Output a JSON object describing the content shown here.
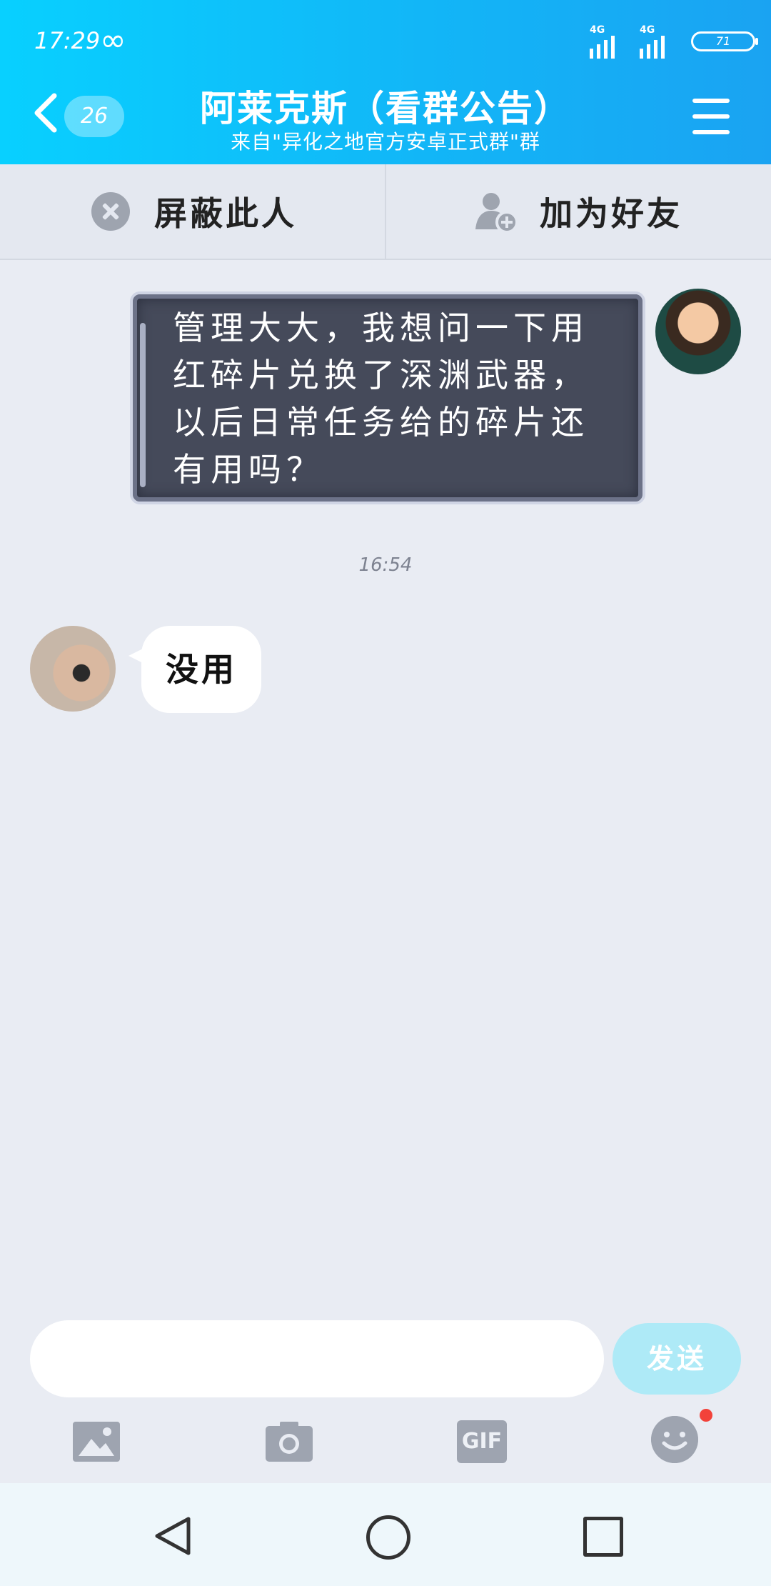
{
  "status_bar": {
    "time": "17:29",
    "infinity_glyph": "∞",
    "network_1": "4G",
    "network_2": "4G",
    "battery": "71"
  },
  "header": {
    "unread_count": "26",
    "title": "阿莱克斯（看群公告）",
    "subtitle": "来自\"异化之地官方安卓正式群\"群"
  },
  "actions": {
    "block_label": "屏蔽此人",
    "add_friend_label": "加为好友"
  },
  "messages": [
    {
      "side": "right",
      "text": "管理大大，我想问一下用红碎片兑换了深渊武器，以后日常任务给的碎片还有用吗？"
    },
    {
      "side": "left",
      "text": "没用"
    }
  ],
  "timestamp": "16:54",
  "input": {
    "placeholder": "",
    "send_label": "发送"
  },
  "toolbar": {
    "gif_label": "GIF"
  },
  "colors": {
    "header_start": "#08d0ff",
    "header_end": "#1aa3f2",
    "background": "#e9ecf3",
    "send_button": "#aeeaf7",
    "notification_dot": "#f2423a"
  }
}
